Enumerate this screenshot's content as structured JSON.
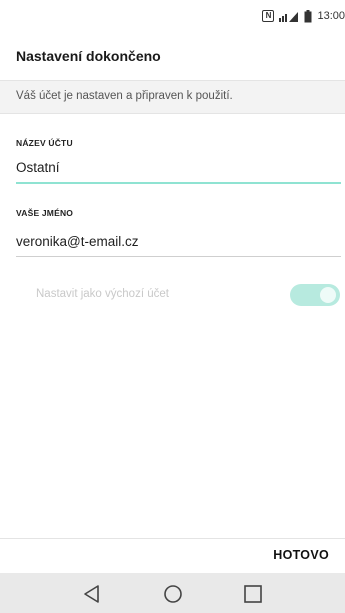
{
  "status_bar": {
    "nfc_glyph": "N",
    "time": "13:00",
    "icons": [
      "nfc-icon",
      "signal-icon",
      "battery-icon"
    ]
  },
  "header": {
    "title": "Nastavení dokončeno"
  },
  "info": {
    "text": "Váš účet je nastaven a připraven k použití."
  },
  "fields": {
    "account_name": {
      "label": "NÁZEV ÚČTU",
      "value": "Ostatní"
    },
    "your_name": {
      "label": "VAŠE JMÉNO",
      "value": "veronika@t-email.cz"
    }
  },
  "default_account": {
    "label": "Nastavit jako výchozí účet",
    "enabled": true
  },
  "footer": {
    "done_label": "HOTOVO"
  },
  "nav": {
    "icons": [
      "back-icon",
      "home-icon",
      "recents-icon"
    ]
  },
  "colors": {
    "accent": "#8fe3d2",
    "toggle_track": "#b7eadf",
    "nav_background": "#e9e9e9"
  }
}
